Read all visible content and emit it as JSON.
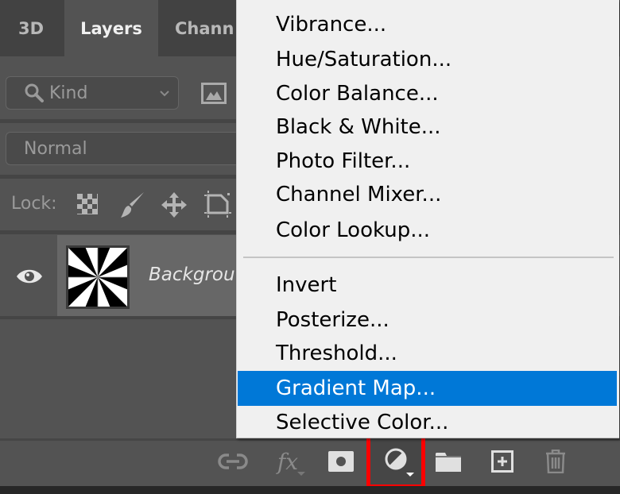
{
  "tabs": [
    {
      "label": "3D",
      "active": false
    },
    {
      "label": "Layers",
      "active": true
    },
    {
      "label": "Chann",
      "active": false
    }
  ],
  "filter": {
    "icon": "search-icon",
    "value": "Kind",
    "dropdown_icon": "chevron-down-icon",
    "image_filter_icon": "image-icon"
  },
  "blend_mode": {
    "value": "Normal"
  },
  "lock": {
    "label": "Lock:",
    "icons": [
      "transparency-lock-icon",
      "brush-lock-icon",
      "move-lock-icon",
      "artboard-lock-icon"
    ]
  },
  "layers": [
    {
      "name": "Backgrou",
      "visible": true,
      "visibility_icon": "eye-icon",
      "thumbnail": "starburst"
    }
  ],
  "menu": {
    "group1": [
      "Vibrance...",
      "Hue/Saturation...",
      "Color Balance...",
      "Black & White...",
      "Photo Filter...",
      "Channel Mixer...",
      "Color Lookup..."
    ],
    "group2": [
      "Invert",
      "Posterize...",
      "Threshold...",
      "Gradient Map...",
      "Selective Color..."
    ],
    "highlighted": "Gradient Map...",
    "highlight_color": "#0078d7"
  },
  "footer": {
    "buttons": [
      "link-layers-icon",
      "fx-icon",
      "add-mask-icon",
      "adjustment-layer-icon",
      "new-group-icon",
      "new-layer-icon",
      "delete-icon"
    ],
    "fx_label": "fx",
    "highlighted_button": "adjustment-layer-icon",
    "highlight_color": "#ff0000"
  }
}
